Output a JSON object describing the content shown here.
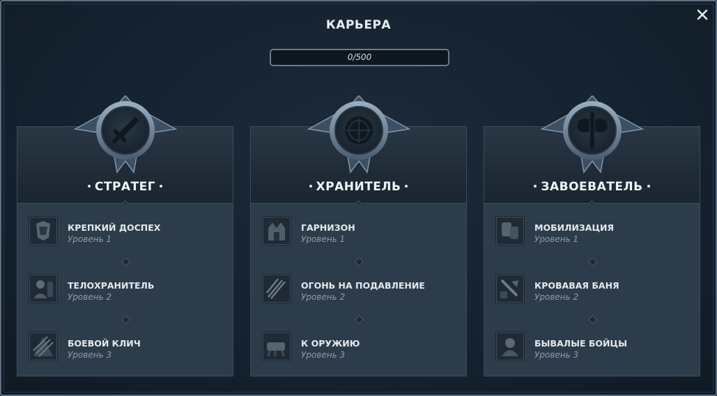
{
  "window": {
    "title": "КАРЬЕРА",
    "close_icon": "close-icon"
  },
  "progress": {
    "text": "0/500",
    "fraction": 0
  },
  "columns": [
    {
      "name": "СТРАТЕГ",
      "emblem_icon": "sword-icon",
      "skills": [
        {
          "name": "КРЕПКИЙ ДОСПЕХ",
          "level": "Уровень 1",
          "icon": "armor-icon"
        },
        {
          "name": "ТЕЛОХРАНИТЕЛЬ",
          "level": "Уровень 2",
          "icon": "bodyguard-icon"
        },
        {
          "name": "БОЕВОЙ КЛИЧ",
          "level": "Уровень 3",
          "icon": "battle-cry-icon"
        }
      ]
    },
    {
      "name": "ХРАНИТЕЛЬ",
      "emblem_icon": "shield-icon",
      "skills": [
        {
          "name": "ГАРНИЗОН",
          "level": "Уровень 1",
          "icon": "garrison-icon"
        },
        {
          "name": "ОГОНЬ НА ПОДАВЛЕНИЕ",
          "level": "Уровень 2",
          "icon": "suppressing-fire-icon"
        },
        {
          "name": "К ОРУЖИЮ",
          "level": "Уровень 3",
          "icon": "to-arms-icon"
        }
      ]
    },
    {
      "name": "ЗАВОЕВАТЕЛЬ",
      "emblem_icon": "double-axe-icon",
      "skills": [
        {
          "name": "МОБИЛИЗАЦИЯ",
          "level": "Уровень 1",
          "icon": "mobilization-icon"
        },
        {
          "name": "КРОВАВАЯ БАНЯ",
          "level": "Уровень 2",
          "icon": "bloodbath-icon"
        },
        {
          "name": "БЫВАЛЫЕ БОЙЦЫ",
          "level": "Уровень 3",
          "icon": "veteran-fighters-icon"
        }
      ]
    }
  ],
  "colors": {
    "background": "#152230",
    "panel": "#2d3c4b",
    "border": "#5b6e80",
    "text": "#e4e9ed",
    "muted_text": "#8f9ba6"
  }
}
